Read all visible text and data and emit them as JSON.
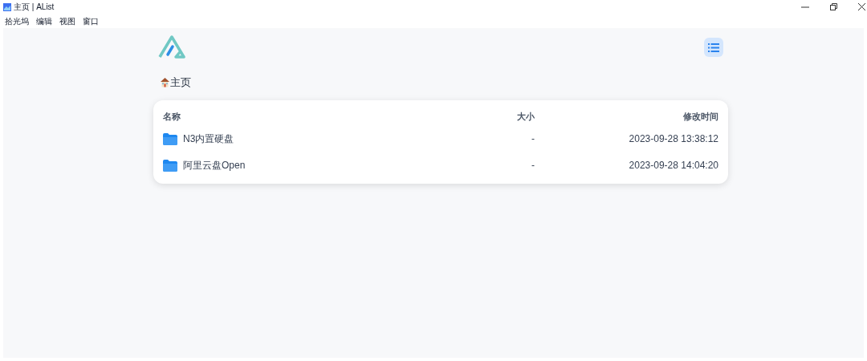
{
  "window": {
    "title": "主页 | AList"
  },
  "menu": [
    "拾光坞",
    "编辑",
    "视图",
    "窗口"
  ],
  "breadcrumb": "主页",
  "table": {
    "columns": [
      "名称",
      "大小",
      "修改时间"
    ],
    "rows": [
      {
        "name": "N3内置硬盘",
        "size": "-",
        "modified": "2023-09-28 13:38:12"
      },
      {
        "name": "阿里云盘Open",
        "size": "-",
        "modified": "2023-09-28 14:04:20"
      }
    ]
  }
}
